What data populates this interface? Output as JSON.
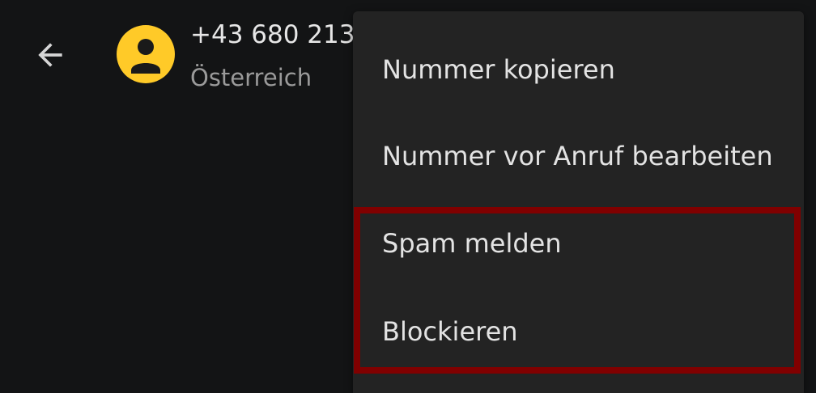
{
  "header": {
    "back_icon": "arrow-back-icon",
    "avatar_icon": "person-icon",
    "phone_number": "+43 680 213…",
    "country": "Österreich"
  },
  "menu": {
    "items": [
      {
        "label": "Nummer kopieren"
      },
      {
        "label": "Nummer vor Anruf bearbeiten"
      },
      {
        "label": "Spam melden"
      },
      {
        "label": "Blockieren"
      }
    ]
  },
  "colors": {
    "background": "#131415",
    "menu_background": "#232323",
    "avatar": "#ffca28",
    "highlight": "#800000"
  }
}
